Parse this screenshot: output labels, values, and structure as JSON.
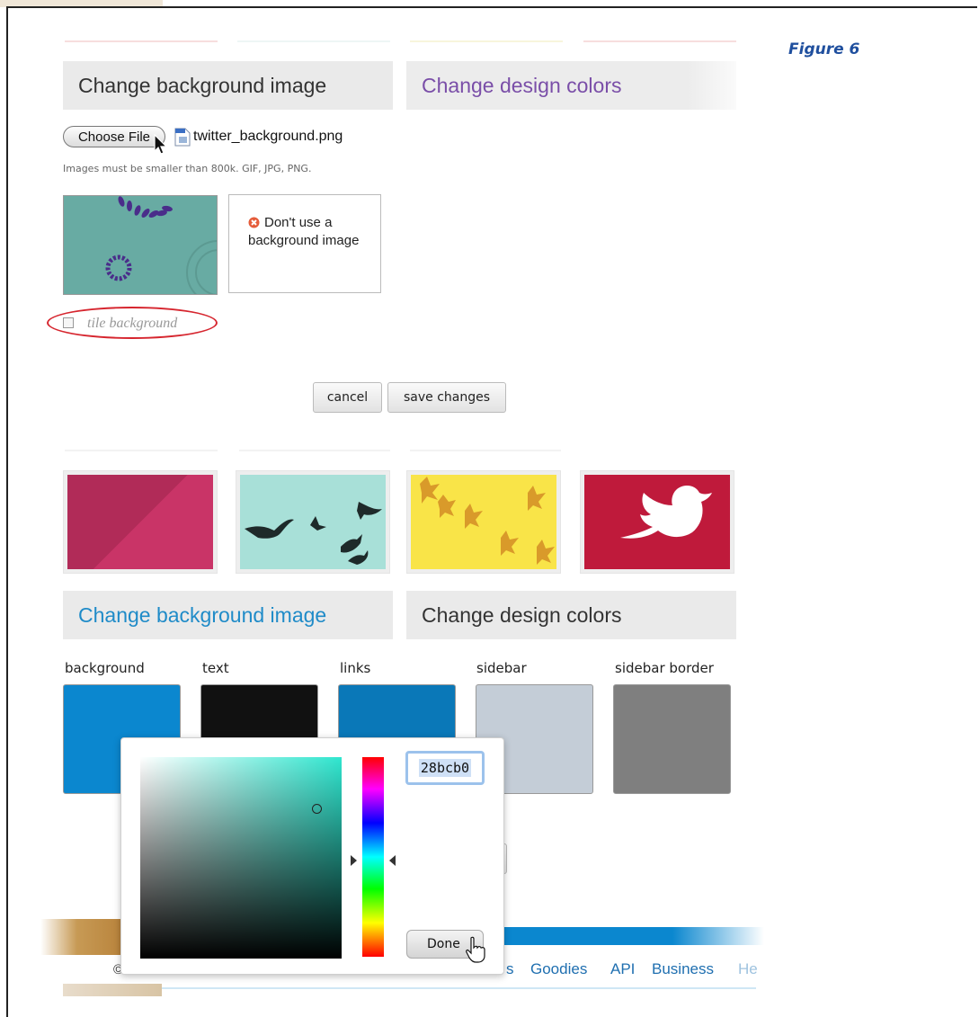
{
  "figure_label": "Figure 6",
  "top_panel": {
    "tab_image": "Change background image",
    "tab_colors": "Change design colors",
    "choose_file_label": "Choose File",
    "file_name": "twitter_background.png",
    "hint": "Images must be smaller than 800k. GIF, JPG, PNG.",
    "no_bg_label": "Don't use a background image",
    "tile_label": "tile background",
    "tile_checked": false,
    "cancel_label": "cancel",
    "save_label": "save changes"
  },
  "bottom_panel": {
    "tab_image": "Change background image",
    "tab_colors": "Change design colors",
    "swatches": [
      {
        "label": "background",
        "color": "#0b87cf"
      },
      {
        "label": "text",
        "color": "#111111"
      },
      {
        "label": "links",
        "color": "#0a78b8"
      },
      {
        "label": "sidebar",
        "color": "#c4cdd7"
      },
      {
        "label": "sidebar border",
        "color": "#7f7f7f"
      }
    ]
  },
  "color_picker": {
    "hex_value": "28bcb0",
    "done_label": "Done"
  },
  "footer": {
    "fragment_left": "©",
    "fragment_mid": "s",
    "links": [
      "Goodies",
      "API",
      "Business",
      "He"
    ]
  }
}
